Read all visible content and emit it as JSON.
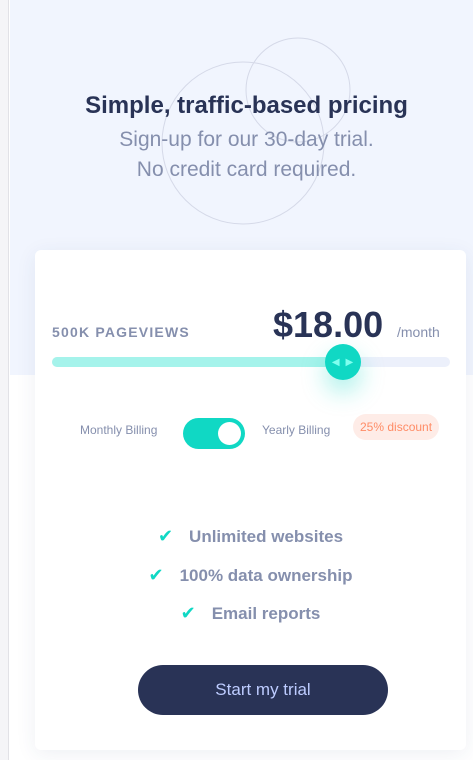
{
  "header": {
    "title": "Simple, traffic-based pricing",
    "subtitle_line1": "Sign-up for our 30-day trial.",
    "subtitle_line2": "No credit card required."
  },
  "pricing": {
    "pageviews": "500K PAGEVIEWS",
    "price": "$18.00",
    "period": "/month",
    "slider_fraction": 0.73
  },
  "billing": {
    "monthly_label": "Monthly Billing",
    "yearly_label": "Yearly Billing",
    "yearly_enabled": true,
    "discount_badge": "25% discount"
  },
  "features": [
    "Unlimited websites",
    "100% data ownership",
    "Email reports"
  ],
  "cta": {
    "label": "Start my trial"
  },
  "colors": {
    "accent": "#10d8c4",
    "dark": "#293356",
    "muted": "#858fad",
    "discount": "#ff8c66"
  }
}
